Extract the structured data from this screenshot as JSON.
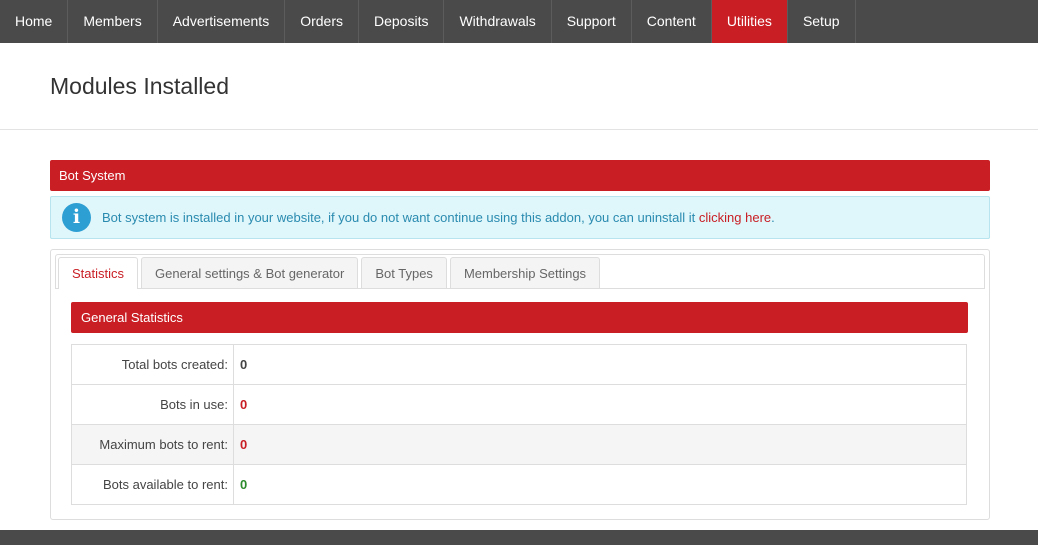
{
  "nav": {
    "items": [
      "Home",
      "Members",
      "Advertisements",
      "Orders",
      "Deposits",
      "Withdrawals",
      "Support",
      "Content",
      "Utilities",
      "Setup"
    ],
    "active_index": 8
  },
  "page": {
    "title": "Modules Installed"
  },
  "panel": {
    "title": "Bot System"
  },
  "alert": {
    "icon": "info-icon",
    "text": "Bot system is installed in your website, if you do not want continue using this addon, you can uninstall it ",
    "link": "clicking here",
    "suffix": "."
  },
  "tabs": {
    "items": [
      "Statistics",
      "General settings & Bot generator",
      "Bot Types",
      "Membership Settings"
    ],
    "active_index": 0
  },
  "stats": {
    "title": "General Statistics",
    "rows": [
      {
        "label": "Total bots created:",
        "value": "0"
      },
      {
        "label": "Bots in use:",
        "value": "0"
      },
      {
        "label": "Maximum bots to rent:",
        "value": "0"
      },
      {
        "label": "Bots available to rent:",
        "value": "0"
      }
    ]
  },
  "colors": {
    "accent": "#c81e24",
    "nav_bg": "#4a4a4a",
    "info": "#2a8bb0",
    "value_green": "#2b8a2b"
  }
}
